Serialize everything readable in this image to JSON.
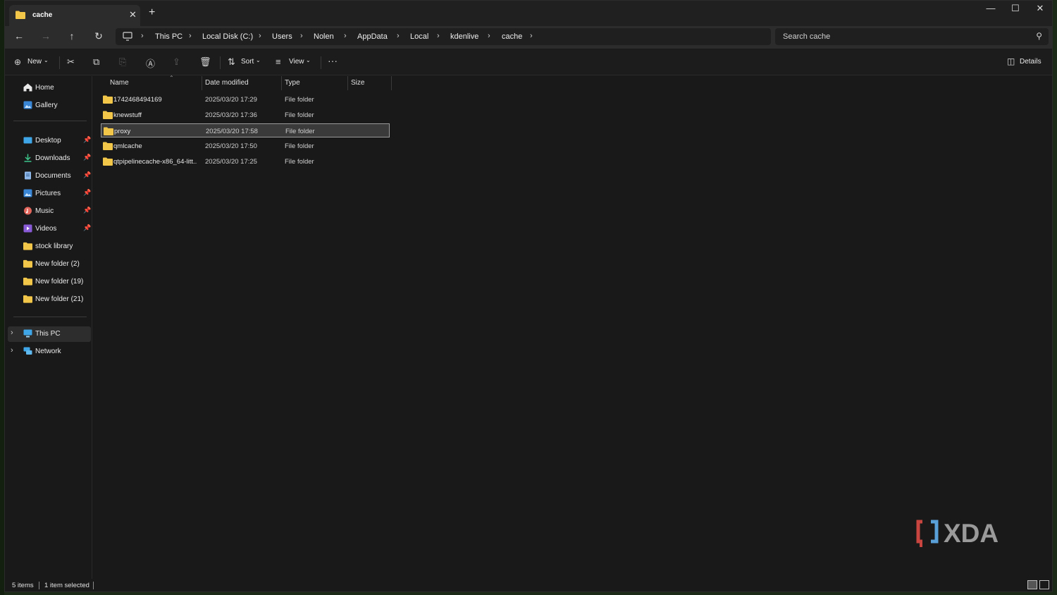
{
  "tab": {
    "title": "cache"
  },
  "window_controls": [
    "minimize",
    "maximize",
    "close"
  ],
  "breadcrumbs": [
    "This PC",
    "Local Disk (C:)",
    "Users",
    "Nolen",
    "AppData",
    "Local",
    "kdenlive",
    "cache"
  ],
  "search": {
    "placeholder": "Search cache"
  },
  "toolbar": {
    "new_label": "New",
    "sort_label": "Sort",
    "view_label": "View",
    "details_label": "Details"
  },
  "sidebar": {
    "quick": [
      {
        "label": "Home",
        "icon": "home-icon"
      },
      {
        "label": "Gallery",
        "icon": "gallery-icon"
      }
    ],
    "pinned": [
      {
        "label": "Desktop",
        "icon": "desktop-icon",
        "pinned": true
      },
      {
        "label": "Downloads",
        "icon": "downloads-icon",
        "pinned": true
      },
      {
        "label": "Documents",
        "icon": "documents-icon",
        "pinned": true
      },
      {
        "label": "Pictures",
        "icon": "pictures-icon",
        "pinned": true
      },
      {
        "label": "Music",
        "icon": "music-icon",
        "pinned": true
      },
      {
        "label": "Videos",
        "icon": "videos-icon",
        "pinned": true
      },
      {
        "label": "stock library",
        "icon": "folder-icon",
        "pinned": false
      },
      {
        "label": "New folder (2)",
        "icon": "folder-icon",
        "pinned": false
      },
      {
        "label": "New folder (19)",
        "icon": "folder-icon",
        "pinned": false
      },
      {
        "label": "New folder (21)",
        "icon": "folder-icon",
        "pinned": false
      }
    ],
    "devices": [
      {
        "label": "This PC",
        "icon": "this-pc-icon",
        "selected": true
      },
      {
        "label": "Network",
        "icon": "network-icon",
        "selected": false
      }
    ]
  },
  "columns": [
    "Name",
    "Date modified",
    "Type",
    "Size"
  ],
  "files": [
    {
      "name": "1742468494169",
      "date": "2025/03/20 17:29",
      "type": "File folder",
      "size": "",
      "selected": false
    },
    {
      "name": "knewstuff",
      "date": "2025/03/20 17:36",
      "type": "File folder",
      "size": "",
      "selected": false
    },
    {
      "name": "proxy",
      "date": "2025/03/20 17:58",
      "type": "File folder",
      "size": "",
      "selected": true
    },
    {
      "name": "qmlcache",
      "date": "2025/03/20 17:50",
      "type": "File folder",
      "size": "",
      "selected": false
    },
    {
      "name": "qtpipelinecache-x86_64-litt...",
      "date": "2025/03/20 17:25",
      "type": "File folder",
      "size": "",
      "selected": false
    }
  ],
  "status": {
    "items": "5 items",
    "selected": "1 item selected"
  },
  "watermark": "XDA",
  "colors": {
    "folder": "#f2c649",
    "background": "#191919",
    "selection": "#3a3a3a"
  }
}
